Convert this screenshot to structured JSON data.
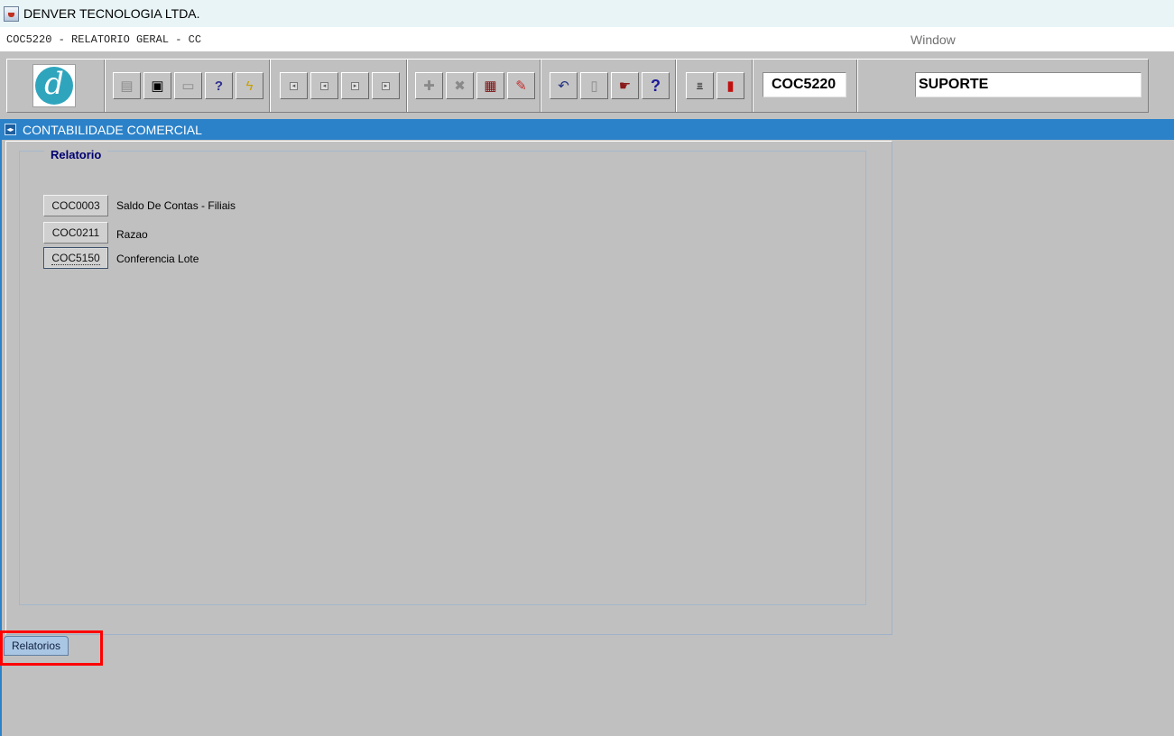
{
  "window": {
    "title": "DENVER TECNOLOGIA LTDA."
  },
  "menubar": {
    "module_title": "COC5220 - RELATORIO GERAL - CC",
    "window_menu": "Window"
  },
  "toolbar": {
    "logo_letter": "d",
    "buttons": [
      {
        "name": "save",
        "icon": "floppy-icon",
        "glyph": "💾"
      },
      {
        "name": "enter-query",
        "icon": "window-icon",
        "glyph": "▣"
      },
      {
        "name": "print",
        "icon": "printer-icon",
        "glyph": "⎙"
      },
      {
        "name": "query",
        "icon": "question-pencil-icon",
        "glyph": "✎?"
      },
      {
        "name": "execute-query",
        "icon": "lightning-pencil-icon",
        "glyph": "⚡"
      },
      {
        "name": "first-record",
        "icon": "first-record-icon",
        "glyph": "⏮"
      },
      {
        "name": "previous-record",
        "icon": "previous-record-icon",
        "glyph": "◀"
      },
      {
        "name": "next-record",
        "icon": "next-record-icon",
        "glyph": "▶"
      },
      {
        "name": "last-record",
        "icon": "last-record-icon",
        "glyph": "⏭"
      },
      {
        "name": "insert-record",
        "icon": "plus-icon",
        "glyph": "✚"
      },
      {
        "name": "delete-record",
        "icon": "x-icon",
        "glyph": "✖"
      },
      {
        "name": "edit-window",
        "icon": "window-edit-icon",
        "glyph": "🗗"
      },
      {
        "name": "edit-field",
        "icon": "pencil-icon",
        "glyph": "✏"
      },
      {
        "name": "undo",
        "icon": "undo-icon",
        "glyph": "↶"
      },
      {
        "name": "clipboard",
        "icon": "clipboard-icon",
        "glyph": "📋"
      },
      {
        "name": "list-values",
        "icon": "hand-list-icon",
        "glyph": "☛"
      },
      {
        "name": "help",
        "icon": "question-icon",
        "glyph": "?"
      },
      {
        "name": "menu",
        "icon": "menu-icon",
        "glyph": "Menu"
      },
      {
        "name": "exit",
        "icon": "exit-door-icon",
        "glyph": "🚪"
      }
    ],
    "program_code": "COC5220",
    "user": "SUPORTE"
  },
  "form": {
    "title": "CONTABILIDADE COMERCIAL"
  },
  "frame": {
    "title": "Relatorio",
    "reports": [
      {
        "code": "COC0003",
        "label": "Saldo De Contas - Filiais"
      },
      {
        "code": "COC0211",
        "label": "Razao"
      },
      {
        "code": "COC5150",
        "label": "Conferencia Lote"
      }
    ]
  },
  "tabs": [
    {
      "label": "Relatorios"
    }
  ],
  "colors": {
    "form_bar": "#2b82c9",
    "highlight": "#ff0000",
    "frame_title": "#000070"
  }
}
